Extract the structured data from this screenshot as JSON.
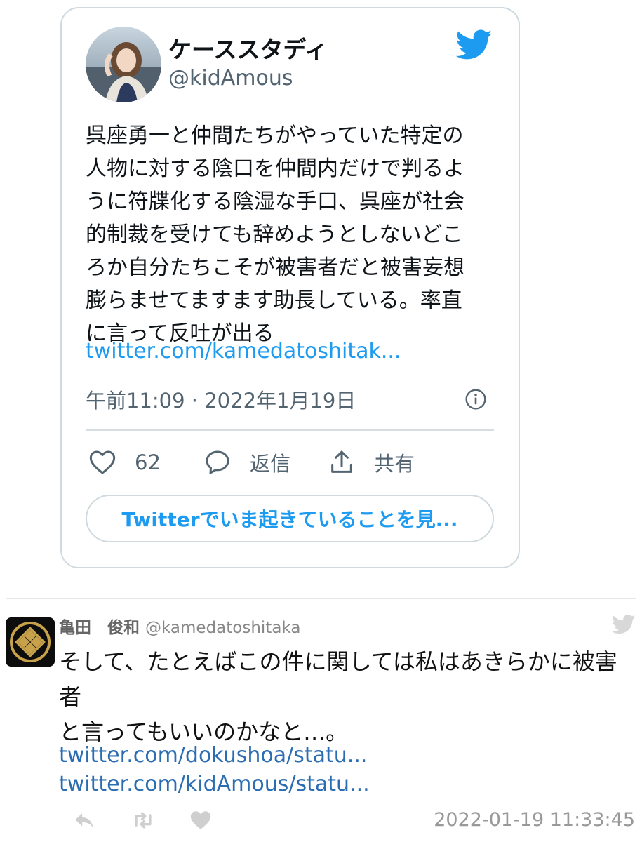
{
  "embedded_tweet": {
    "author_name": "ケーススタディ",
    "author_handle": "@kidAmous",
    "text": "呉座勇一と仲間たちがやっていた特定の\n人物に対する陰口を仲間内だけで判るよ\nうに符牒化する陰湿な手口、呉座が社会\n的制裁を受けても辞めようとしないどこ\nろか自分たちこそが被害者だと被害妄想\n膨らませてますます助長している。率直\nに言って反吐が出る",
    "link": "twitter.com/kamedatoshitak...",
    "timestamp": "午前11:09 · 2022年1月19日",
    "likes": "62",
    "reply_label": "返信",
    "share_label": "共有",
    "cta_label": "Twitterでいま起きていることを見..."
  },
  "reply_tweet": {
    "author_name": "亀田　俊和",
    "author_handle": "@kamedatoshitaka",
    "text": "そして、たとえばこの件に関しては私はあきらかに被害者\nと言ってもいいのかなと…。",
    "links": [
      "twitter.com/dokushoa/statu...",
      "twitter.com/kidAmous/statu..."
    ],
    "datetime": "2022-01-19 11:33:45"
  },
  "icons": [
    "twitter-bird-icon",
    "info-icon",
    "heart-icon",
    "reply-bubble-icon",
    "share-icon",
    "reply-arrow-icon",
    "retweet-icon",
    "like-heart-icon"
  ],
  "colors": {
    "twitter_blue": "#1d9bf0",
    "text_gray": "#536471",
    "border": "#cfd9de",
    "link_blue": "#2a6db3"
  }
}
